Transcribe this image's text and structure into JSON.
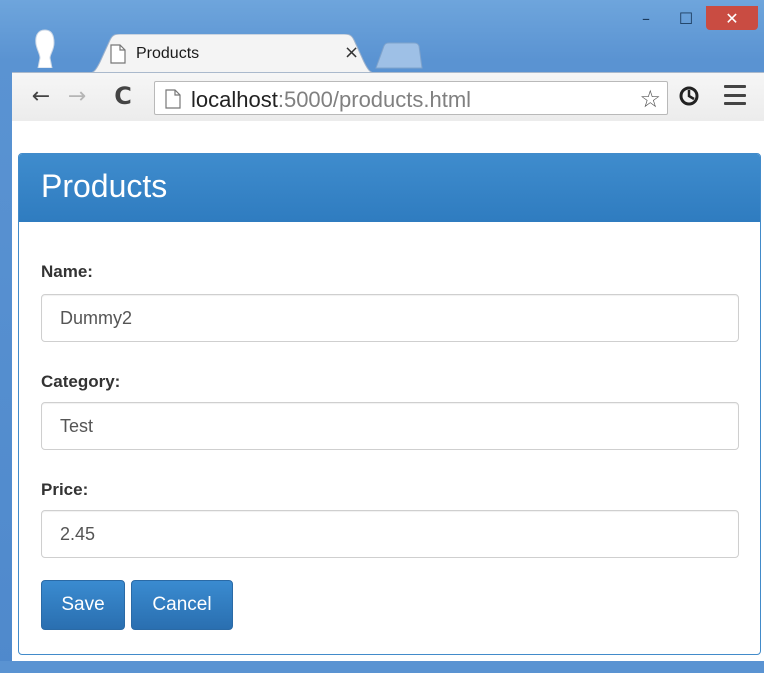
{
  "window": {
    "controls": {
      "minimize": "–",
      "maximize": "☐",
      "close": "✕"
    }
  },
  "tab": {
    "title": "Products",
    "close": "×"
  },
  "toolbar": {
    "back": "←",
    "forward": "→",
    "reload": "C",
    "url_host": "localhost",
    "url_rest": ":5000/products.html",
    "star": "☆"
  },
  "page": {
    "heading": "Products",
    "fields": [
      {
        "label": "Name:",
        "value": "Dummy2"
      },
      {
        "label": "Category:",
        "value": "Test"
      },
      {
        "label": "Price:",
        "value": "2.45"
      }
    ],
    "save_label": "Save",
    "cancel_label": "Cancel"
  },
  "colors": {
    "primary": "#337ab7",
    "window_frame": "#5a93d2",
    "close_button": "#c94c42"
  }
}
